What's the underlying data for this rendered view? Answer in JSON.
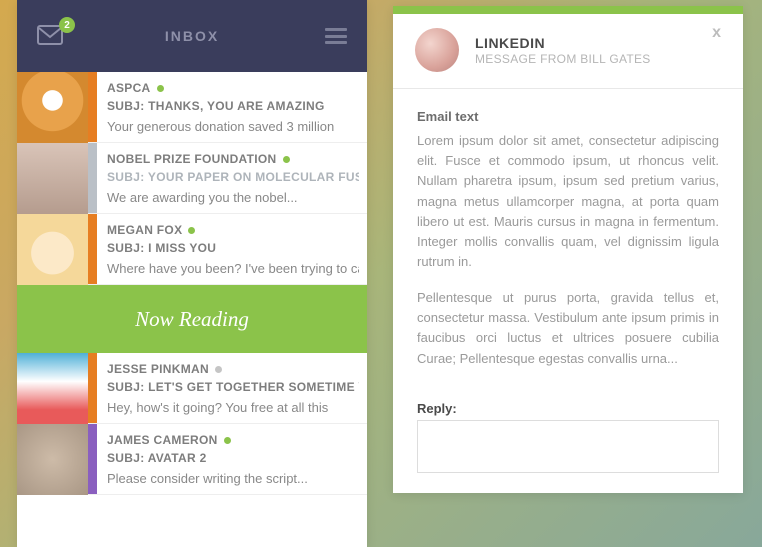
{
  "header": {
    "title": "INBOX",
    "badge": "2"
  },
  "now_reading": "Now Reading",
  "messages": [
    {
      "sender": "ASPCA",
      "subject": "SUBJ: THANKS, YOU ARE AMAZING",
      "preview": "Your generous donation saved 3 million",
      "accent": "#e67e22",
      "dot": "#8bc34a",
      "subj_color": "#7d7d7d",
      "avatar_class": "av-tiger"
    },
    {
      "sender": "NOBEL PRIZE FOUNDATION",
      "subject": "SUBJ: YOUR PAPER ON MOLECULAR FUSION",
      "preview": "We are awarding you the nobel...",
      "accent": "#bac0c7",
      "dot": "#8bc34a",
      "subj_color": "#aeb4ba",
      "avatar_class": "av-girl"
    },
    {
      "sender": "MEGAN FOX",
      "subject": "SUBJ: I MISS YOU",
      "preview": "Where have you been? I've been trying to call",
      "accent": "#e67e22",
      "dot": "#8bc34a",
      "subj_color": "#7d7d7d",
      "avatar_class": "av-cat1"
    },
    {
      "sender": "JESSE PINKMAN",
      "subject": "SUBJ: LET'S GET TOGETHER SOMETIME YO!",
      "preview": "Hey, how's it going? You free at all this",
      "accent": "#e67e22",
      "dot": "#c5c5c5",
      "subj_color": "#7d7d7d",
      "avatar_class": "av-girl2"
    },
    {
      "sender": "JAMES CAMERON",
      "subject": "SUBJ: AVATAR 2",
      "preview": "Please consider writing the script...",
      "accent": "#8a5fbf",
      "dot": "#8bc34a",
      "subj_color": "#7d7d7d",
      "avatar_class": "av-cat2"
    }
  ],
  "reader": {
    "title": "LINKEDIN",
    "subtitle": "MESSAGE FROM BILL GATES",
    "close": "x",
    "body_header": "Email text",
    "para1": "Lorem ipsum dolor sit amet, consectetur adipiscing elit. Fusce et commodo ipsum, ut rhoncus velit. Nullam pharetra ipsum, ipsum sed pretium varius, magna metus ullamcorper magna, at porta quam libero ut est. Mauris cursus in magna in fermentum. Integer mollis convallis quam, vel dignissim ligula rutrum in.",
    "para2": "Pellentesque ut purus porta, gravida tellus et, consectetur massa. Vestibulum ante ipsum primis in faucibus orci luctus et ultrices posuere cubilia Curae; Pellentesque egestas convallis urna...",
    "reply_label": "Reply:"
  }
}
